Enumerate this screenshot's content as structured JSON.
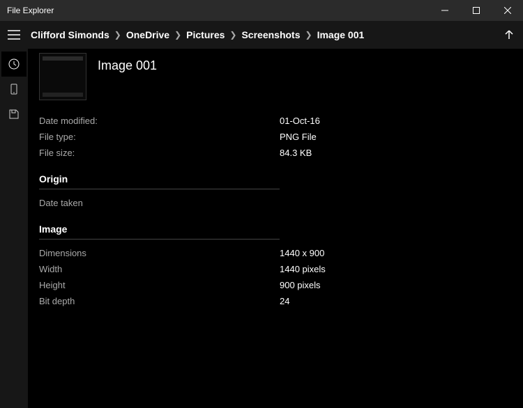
{
  "window": {
    "title": "File Explorer"
  },
  "breadcrumb": {
    "items": [
      "Clifford Simonds",
      "OneDrive",
      "Pictures",
      "Screenshots",
      "Image 001"
    ]
  },
  "file": {
    "name": "Image 001"
  },
  "details": {
    "date_modified": {
      "label": "Date modified:",
      "value": "01-Oct-16"
    },
    "file_type": {
      "label": "File type:",
      "value": "PNG File"
    },
    "file_size": {
      "label": "File size:",
      "value": "84.3 KB"
    }
  },
  "origin": {
    "heading": "Origin",
    "date_taken": {
      "label": "Date taken",
      "value": ""
    }
  },
  "image": {
    "heading": "Image",
    "dimensions": {
      "label": "Dimensions",
      "value": "1440 x 900"
    },
    "width": {
      "label": "Width",
      "value": "1440 pixels"
    },
    "height": {
      "label": "Height",
      "value": "900 pixels"
    },
    "bit_depth": {
      "label": "Bit depth",
      "value": "24"
    }
  },
  "sidebar": {
    "icons": [
      "clock-icon",
      "device-icon",
      "save-icon"
    ]
  }
}
